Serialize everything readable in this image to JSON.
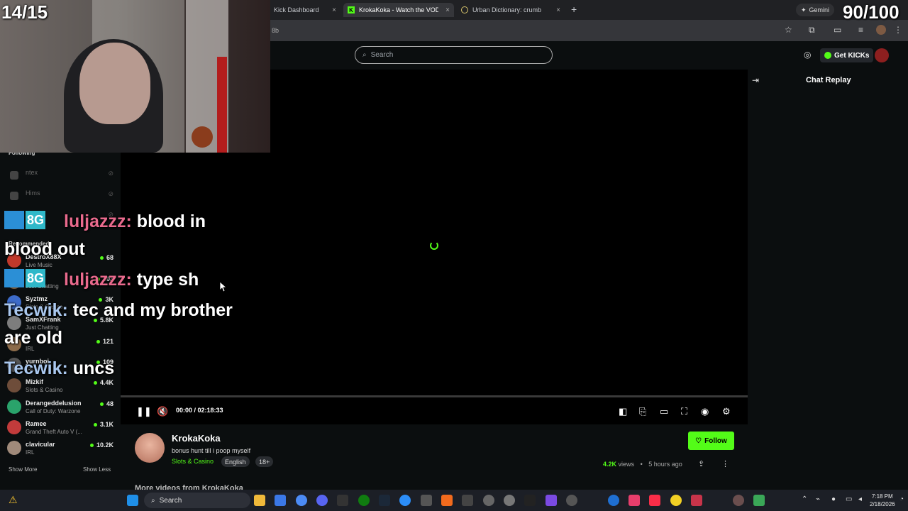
{
  "overlay": {
    "count": "14/15",
    "score": "90/100"
  },
  "browser": {
    "tabs": [
      {
        "label": "Kick Dashboard",
        "close": "×"
      },
      {
        "label": "KrokaKoka - Watch the VOD on",
        "close": "×",
        "active": true
      },
      {
        "label": "Urban Dictionary: crumb",
        "close": "×"
      }
    ],
    "new_tab": "+",
    "gemini": "Gemini",
    "url_fragment": "8b"
  },
  "kick": {
    "search_placeholder": "Search",
    "get_kicks": "Get KICKs"
  },
  "sidebar": {
    "following_heading": "Following",
    "following": [
      {
        "name": "ntex"
      },
      {
        "name": "Hims"
      },
      {
        "name": "..."
      }
    ],
    "recommended_heading": "Recommended",
    "recommended": [
      {
        "name": "DestroX88X",
        "category": "Live Music",
        "count": "68",
        "color": "#c0392b"
      },
      {
        "name": "...",
        "category": "Just Chatting",
        "count": "103",
        "color": "#7a5a3a"
      },
      {
        "name": "Syztmz",
        "category": "Slots & Casino",
        "count": "3K",
        "color": "#3d6bc9"
      },
      {
        "name": "SamXFrank",
        "category": "Just Chatting",
        "count": "5.8K",
        "color": "#7d7d7d"
      },
      {
        "name": "...",
        "category": "IRL",
        "count": "121",
        "color": "#8c6b4a"
      },
      {
        "name": "yurnboi",
        "category": "IRL",
        "count": "109",
        "color": "#555"
      },
      {
        "name": "Mizkif",
        "category": "Slots & Casino",
        "count": "4.4K",
        "color": "#6e4d3a"
      },
      {
        "name": "Derangeddelusion",
        "category": "Call of Duty: Warzone",
        "count": "48",
        "color": "#2aa36b"
      },
      {
        "name": "Ramee",
        "category": "Grand Theft Auto V (...",
        "count": "3.1K",
        "color": "#c23b3b"
      },
      {
        "name": "clavicular",
        "category": "IRL",
        "count": "10.2K",
        "color": "#a08a7a"
      }
    ],
    "show_more": "Show More",
    "show_less": "Show Less"
  },
  "chat_overlay": {
    "messages": [
      {
        "user": "luljazzz:",
        "text": "blood in"
      },
      {
        "text": "blood out"
      },
      {
        "user": "luljazzz:",
        "text": "type sh"
      },
      {
        "user": "Tecwik:",
        "text": "tec and my brother"
      },
      {
        "text": "are old"
      },
      {
        "user": "Tecwik:",
        "text": "uncs"
      }
    ],
    "badge_text": "8G"
  },
  "player": {
    "timecode": "00:00 / 02:18:33"
  },
  "chat_replay": {
    "title": "Chat Replay"
  },
  "stream": {
    "streamer": "KrokaKoka",
    "title": "bonus hunt till i poop myself",
    "category": "Slots & Casino",
    "tags": [
      "English",
      "18+"
    ],
    "follow": "Follow",
    "views": "4.2K",
    "views_label": "views",
    "time_ago": "5 hours ago",
    "more_videos": "More videos from KrokaKoka"
  },
  "taskbar": {
    "search": "Search",
    "time": "7:18 PM",
    "date": "2/18/2026"
  },
  "colors": {
    "accent": "#53fc18"
  }
}
